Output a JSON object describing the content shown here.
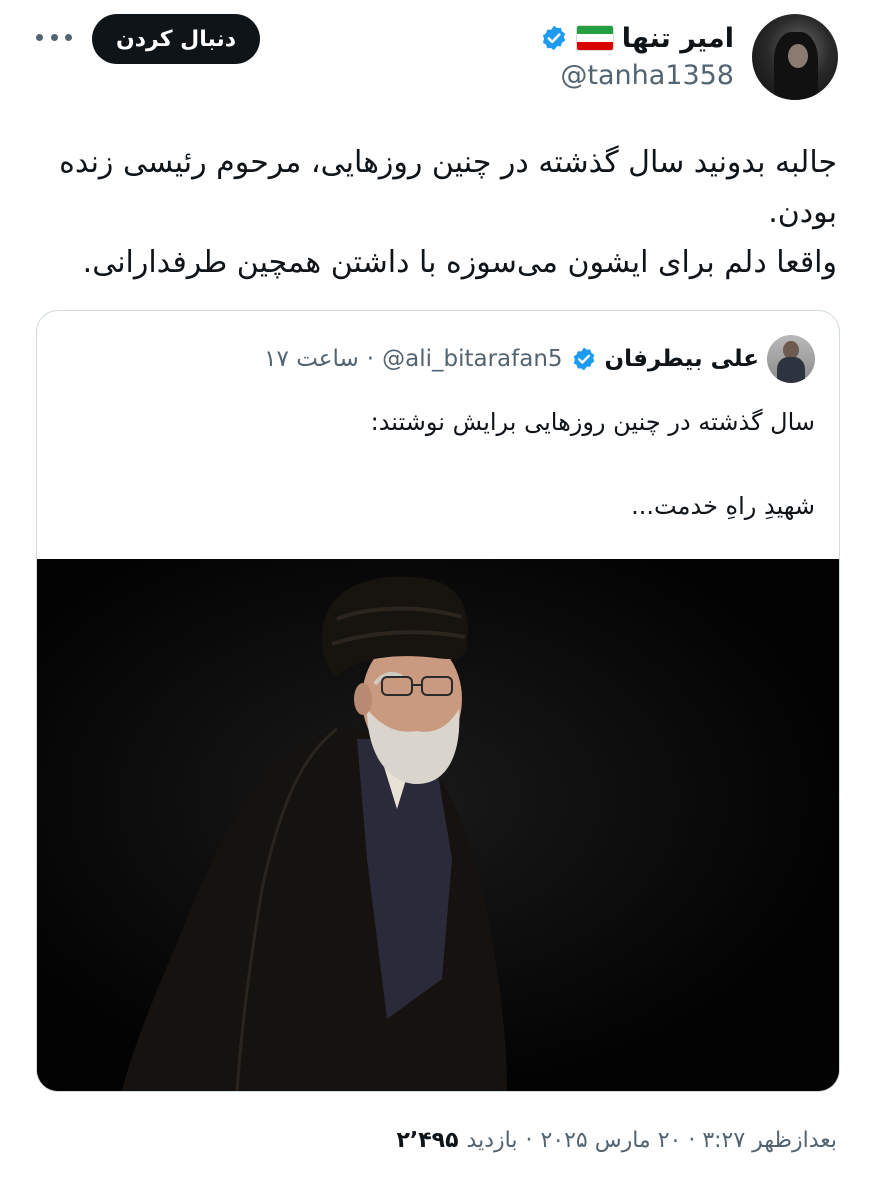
{
  "header": {
    "display_name": "امیر تنها",
    "handle": "@tanha1358",
    "follow_label": "دنبال کردن",
    "flag_colors": [
      "#239f40",
      "#ffffff",
      "#da0000"
    ],
    "verified_color": "#1d9bf0"
  },
  "tweet": {
    "line1": "جالبه بدونید سال گذشته در چنین روزهایی، مرحوم رئیسی زنده",
    "line2": "بودن.",
    "line3": "واقعا دلم برای ایشون می‌سوزه با داشتن همچین طرفدارانی."
  },
  "quote": {
    "display_name": "علی بیطرفان",
    "handle": "@ali_bitarafan5",
    "separator": "·",
    "time": "ساعت ۱۷",
    "line1": "سال گذشته در چنین روزهایی برایش نوشتند:",
    "line2": "شهیدِ راهِ خدمت..."
  },
  "footer": {
    "datetime": "بعدازظهر ۳:۲۷ · ۲۰ مارس ۲۰۲۵",
    "separator": "·",
    "views_label": "بازدید",
    "views_count": "۲٬۴۹۵"
  }
}
